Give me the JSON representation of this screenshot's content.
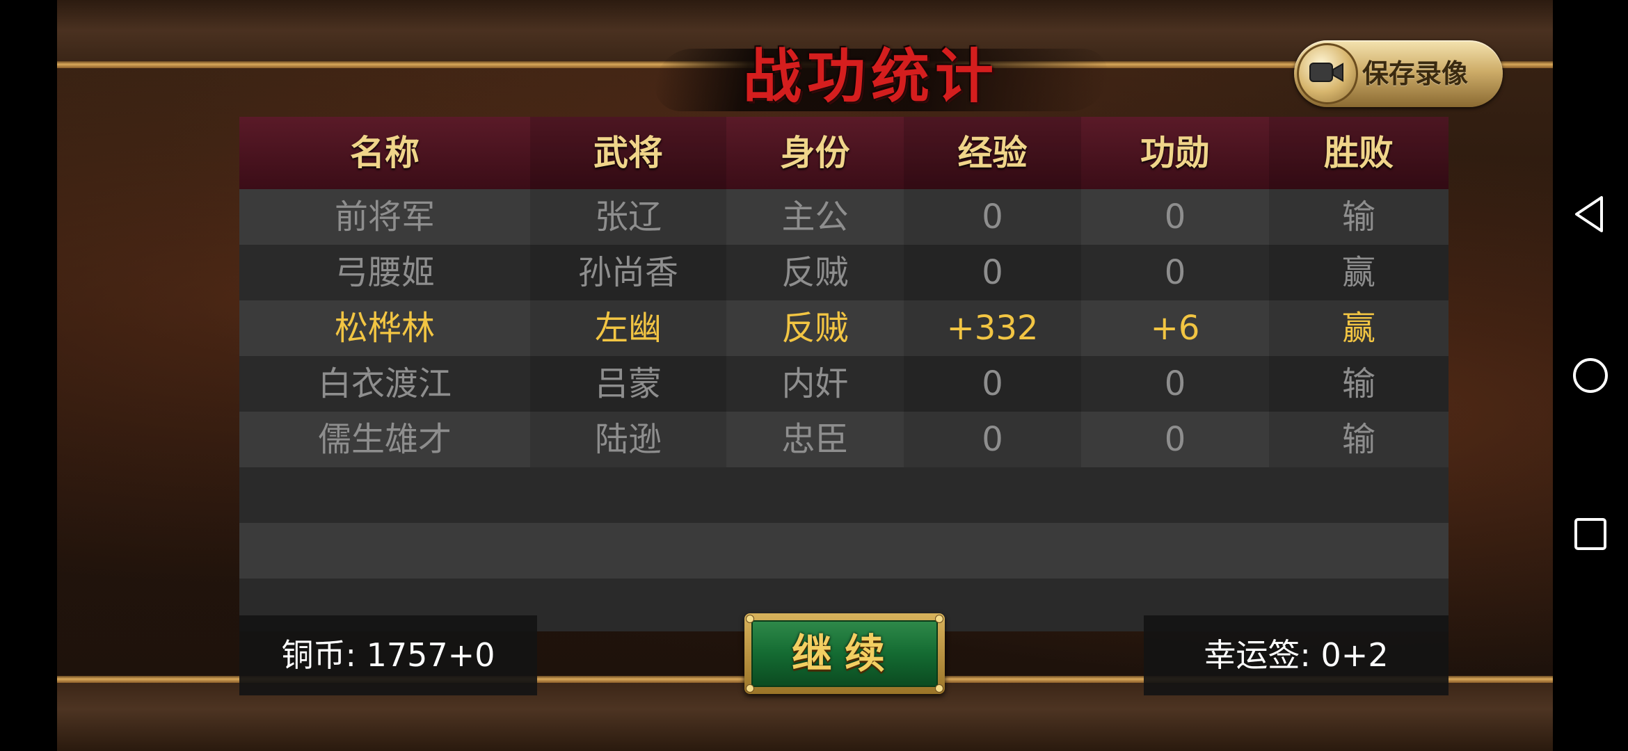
{
  "title": "战功统计",
  "save_button": {
    "label": "保存录像",
    "icon": "video-camera-icon"
  },
  "table": {
    "headers": [
      "名称",
      "武将",
      "身份",
      "经验",
      "功勋",
      "胜败"
    ],
    "rows": [
      {
        "name": "前将军",
        "general": "张辽",
        "identity": "主公",
        "exp": "0",
        "merit": "0",
        "result": "输",
        "is_self": false
      },
      {
        "name": "弓腰姬",
        "general": "孙尚香",
        "identity": "反贼",
        "exp": "0",
        "merit": "0",
        "result": "赢",
        "is_self": false
      },
      {
        "name": "松桦林",
        "general": "左幽",
        "identity": "反贼",
        "exp": "+332",
        "merit": "+6",
        "result": "赢",
        "is_self": true
      },
      {
        "name": "白衣渡江",
        "general": "吕蒙",
        "identity": "内奸",
        "exp": "0",
        "merit": "0",
        "result": "输",
        "is_self": false
      },
      {
        "name": "儒生雄才",
        "general": "陆逊",
        "identity": "忠臣",
        "exp": "0",
        "merit": "0",
        "result": "输",
        "is_self": false
      }
    ]
  },
  "footer": {
    "coins": "铜币: 1757+0",
    "luck": "幸运签: 0+2"
  },
  "continue_button": {
    "label": "继续"
  },
  "system_nav": {
    "back_icon": "back-triangle-icon",
    "home_icon": "home-circle-icon",
    "recents_icon": "recents-square-icon"
  },
  "colors": {
    "title_red": "#d51e1e",
    "header_gold": "#f0d58a",
    "self_highlight": "#f2c543",
    "row_text": "#8e8e8e",
    "header_bg": "#4a1420",
    "continue_green": "#146b32"
  }
}
